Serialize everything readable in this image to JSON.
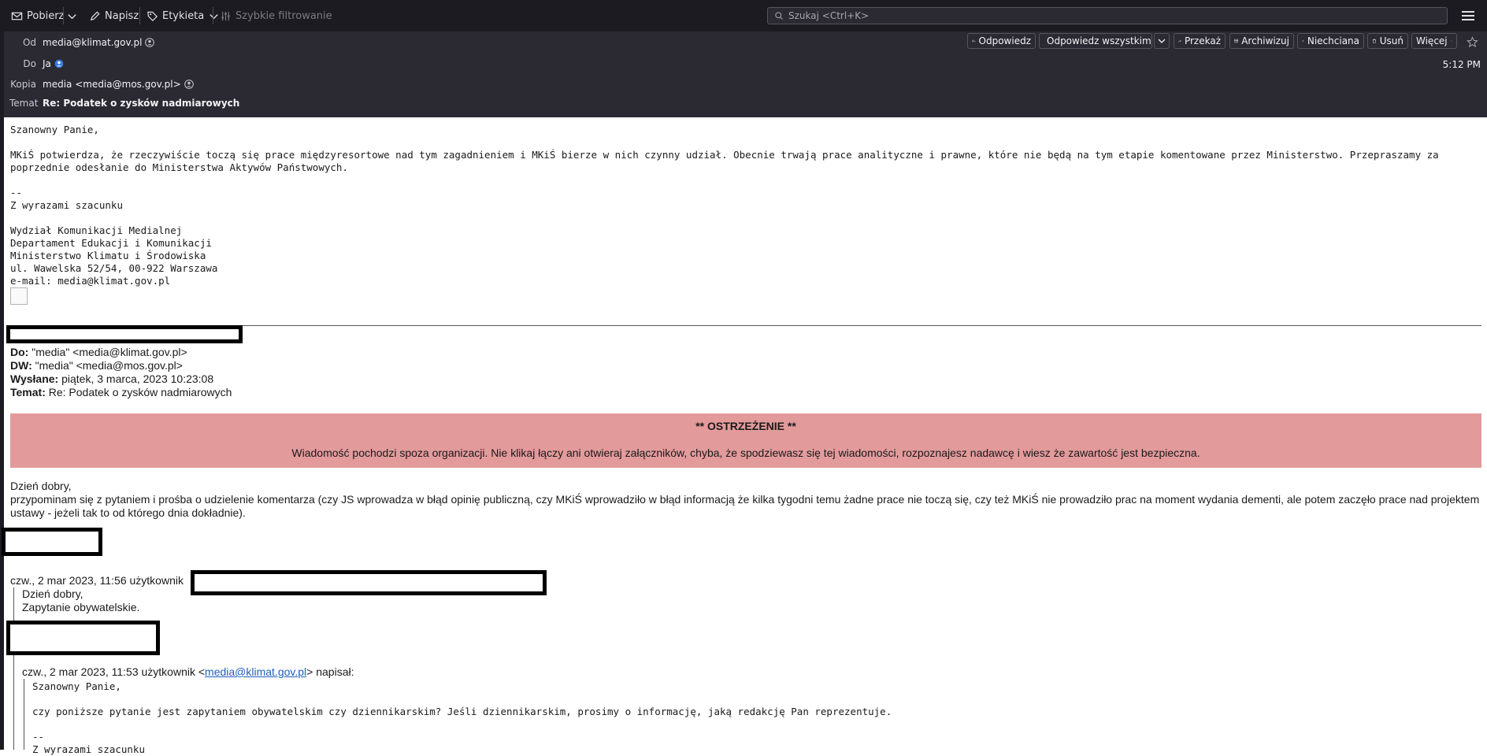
{
  "toolbar": {
    "get_label": "Pobierz",
    "write_label": "Napisz",
    "tag_label": "Etykieta",
    "filter_label": "Szybkie filtrowanie",
    "search_placeholder": "Szukaj <Ctrl+K>"
  },
  "header": {
    "from_label": "Od",
    "from_value": "media@klimat.gov.pl",
    "to_label": "Do",
    "to_value": "Ja",
    "cc_label": "Kopia",
    "cc_value": "media <media@mos.gov.pl>",
    "subject_label": "Temat",
    "subject_value": "Re: Podatek o zysków nadmiarowych",
    "time": "5:12 PM",
    "buttons": {
      "reply": "Odpowiedz",
      "reply_all": "Odpowiedz wszystkim",
      "forward": "Przekaż",
      "archive": "Archiwizuj",
      "junk": "Niechciana",
      "delete": "Usuń",
      "more": "Więcej"
    }
  },
  "message": {
    "greeting": "Szanowny Panie,",
    "paragraph": "MKiŚ potwierdza, że rzeczywiście toczą się prace międzyresortowe nad tym zagadnieniem i MKiŚ bierze w nich czynny udział. Obecnie trwają prace analityczne i prawne, które nie będą na tym etapie komentowane przez Ministerstwo. Przepraszamy za poprzednie odesłanie do Ministerstwa Aktywów Państwowych.",
    "sig_dash": "--",
    "sig_regards": "Z wyrazami szacunku",
    "sig_lines": [
      "Wydział Komunikacji Medialnej",
      "Departament Edukacji i Komunikacji",
      "Ministerstwo Klimatu i Środowiska",
      "ul. Wawelska 52/54, 00-922 Warszawa",
      "e-mail: media@klimat.gov.pl"
    ]
  },
  "quoted": {
    "to_label": "Do:",
    "to_value": "\"media\" <media@klimat.gov.pl>",
    "cc_label": "DW:",
    "cc_value": "\"media\" <media@mos.gov.pl>",
    "sent_label": "Wysłane:",
    "sent_value": "piątek, 3 marca, 2023 10:23:08",
    "subject_label": "Temat:",
    "subject_value": "Re: Podatek o zysków nadmiarowych",
    "warning_title": "** OSTRZEŻENIE **",
    "warning_text": "Wiadomość pochodzi spoza organizacji. Nie klikaj łączy ani otwieraj załączników, chyba, że spodziewasz się tej wiadomości, rozpoznajesz nadawcę i wiesz że zawartość jest bezpieczna.",
    "greeting": "Dzień dobry,",
    "body": "przypominam się z pytaniem i prośba o udzielenie komentarza (czy JS wprowadza w błąd opinię publiczną, czy MKiŚ wprowadziło w błąd informacją że kilka tygodni temu żadne prace nie toczą się, czy też MKiŚ nie prowadziło prac na moment wydania dementi, ale potem zaczęło prace nad projektem ustawy - jeżeli tak to od którego dnia dokładnie).",
    "attribution1": "czw., 2 mar 2023, 11:56 użytkownik",
    "level1_greeting": "Dzień dobry,",
    "level1_body": "Zapytanie obywatelskie.",
    "attribution2_prefix": "czw., 2 mar 2023, 11:53 użytkownik <",
    "attribution2_link": "media@klimat.gov.pl",
    "attribution2_suffix": "> napisał:",
    "level2_greeting": "Szanowny Panie,",
    "level2_body": "czy poniższe pytanie jest zapytaniem obywatelskim czy dziennikarskim? Jeśli dziennikarskim, prosimy o informację, jaką redakcję Pan reprezentuje.",
    "level2_dash": "--",
    "level2_regards": "Z wyrazami szacunku"
  }
}
